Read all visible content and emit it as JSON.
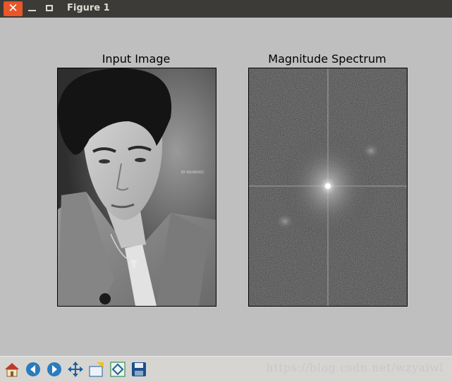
{
  "window": {
    "title": "Figure 1",
    "close_glyph": "✕"
  },
  "figure": {
    "left_panel": {
      "title": "Input Image",
      "image_text": "BY·WUWOOC"
    },
    "right_panel": {
      "title": "Magnitude Spectrum"
    }
  },
  "toolbar": {
    "tools": [
      {
        "icon": "home-icon"
      },
      {
        "icon": "back-arrow-icon"
      },
      {
        "icon": "forward-arrow-icon"
      },
      {
        "icon": "pan-icon"
      },
      {
        "icon": "zoom-rect-icon"
      },
      {
        "icon": "configure-subplots-icon"
      },
      {
        "icon": "save-icon"
      }
    ],
    "watermark": "https://blog.csdn.net/wzyaiwl"
  },
  "colors": {
    "titlebar": "#3c3b37",
    "close": "#e9562a",
    "figure_bg": "#bfbfbf",
    "toolbar_bg": "#d6d5d2"
  }
}
